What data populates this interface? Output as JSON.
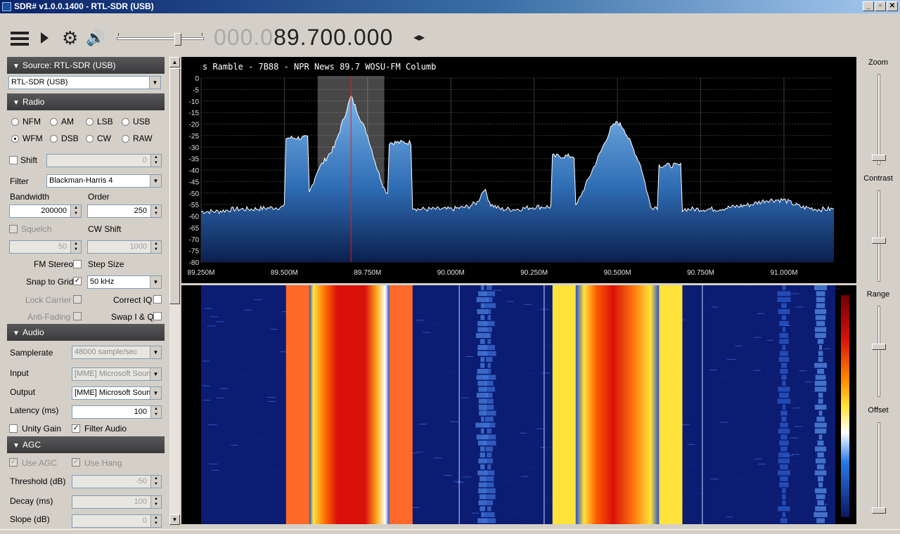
{
  "window": {
    "title": "SDR# v1.0.0.1400 - RTL-SDR (USB)",
    "buttons": {
      "minimize": "_",
      "restore": "▫",
      "close": "✕"
    }
  },
  "toolbar": {
    "menu_icon": "hamburger-menu-icon",
    "play_icon": "play-icon",
    "settings_icon": "gear-icon",
    "audio_icon": "speaker-icon",
    "volume_level": 0.72,
    "frequency_dim": "000.0",
    "frequency_main": "89.700.000",
    "freq_arrows": "◂▸"
  },
  "left": {
    "source": {
      "header": "Source: RTL-SDR (USB)",
      "device": "RTL-SDR (USB)"
    },
    "radio": {
      "header": "Radio",
      "modes": [
        "NFM",
        "AM",
        "LSB",
        "USB",
        "WFM",
        "DSB",
        "CW",
        "RAW"
      ],
      "selected_mode": "WFM",
      "shift_label": "Shift",
      "shift_value": "0",
      "filter_label": "Filter",
      "filter_value": "Blackman-Harris 4",
      "bandwidth_label": "Bandwidth",
      "bandwidth_value": "200000",
      "order_label": "Order",
      "order_value": "250",
      "squelch_label": "Squelch",
      "squelch_value": "50",
      "cwshift_label": "CW Shift",
      "cwshift_value": "1000",
      "fmstereo_label": "FM Stereo",
      "stepsize_label": "Step Size",
      "snap_label": "Snap to Grid",
      "stepsize_value": "50 kHz",
      "lockcarrier_label": "Lock Carrier",
      "correctiq_label": "Correct IQ",
      "antifading_label": "Anti-Fading",
      "swapiq_label": "Swap I & Q"
    },
    "audio": {
      "header": "Audio",
      "samplerate_label": "Samplerate",
      "samplerate_value": "48000 sample/sec",
      "input_label": "Input",
      "input_value": "[MME] Microsoft Soun",
      "output_label": "Output",
      "output_value": "[MME] Microsoft Soun",
      "latency_label": "Latency (ms)",
      "latency_value": "100",
      "unitygain_label": "Unity Gain",
      "filteraudio_label": "Filter Audio"
    },
    "agc": {
      "header": "AGC",
      "useagc_label": "Use AGC",
      "usehang_label": "Use Hang",
      "threshold_label": "Threshold (dB)",
      "threshold_value": "-50",
      "decay_label": "Decay (ms)",
      "decay_value": "100",
      "slope_label": "Slope (dB)",
      "slope_value": "0"
    }
  },
  "right": {
    "zoom_label": "Zoom",
    "contrast_label": "Contrast",
    "range_label": "Range",
    "offset_label": "Offset",
    "zoom_level": 0.05,
    "contrast_level": 0.45,
    "range_level": 0.55,
    "offset_level": 0.0
  },
  "chart_data": {
    "type": "area",
    "title": "s Ramble - 7B88 - NPR News 89.7 WOSU-FM Columb",
    "xlabel": "",
    "ylabel": "",
    "x_unit": "MHz",
    "xlim": [
      89.25,
      91.15
    ],
    "ylim": [
      -80,
      0
    ],
    "x_ticks": [
      "89.250M",
      "89.500M",
      "89.750M",
      "90.000M",
      "90.250M",
      "90.500M",
      "90.750M",
      "91.000M"
    ],
    "y_ticks": [
      "0",
      "-5",
      "-10",
      "-15",
      "-20",
      "-25",
      "-30",
      "-35",
      "-40",
      "-45",
      "-50",
      "-55",
      "-60",
      "-65",
      "-70",
      "-75",
      "-80"
    ],
    "tuned_frequency_mhz": 89.7,
    "filter_band_mhz": [
      89.6,
      89.8
    ],
    "grid": true,
    "series": [
      {
        "x": [
          89.25,
          89.3,
          89.35,
          89.4,
          89.5,
          89.505,
          89.55,
          89.57,
          89.575,
          89.6,
          89.65,
          89.7,
          89.75,
          89.78,
          89.8,
          89.81,
          89.815,
          89.88,
          89.885,
          89.9,
          89.95,
          90.0,
          90.05,
          90.08,
          90.1,
          90.12,
          90.15,
          90.2,
          90.25,
          90.28,
          90.3,
          90.305,
          90.37,
          90.375,
          90.4,
          90.45,
          90.48,
          90.5,
          90.52,
          90.57,
          90.6,
          90.62,
          90.625,
          90.69,
          90.695,
          90.75,
          90.8,
          90.85,
          90.9,
          90.95,
          91.0,
          91.05,
          91.1,
          91.15
        ],
        "values": [
          -58,
          -58,
          -57,
          -57,
          -56,
          -26,
          -26,
          -26,
          -50,
          -40,
          -30,
          -8,
          -25,
          -40,
          -48,
          -50,
          -28,
          -28,
          -56,
          -57,
          -57,
          -57,
          -56,
          -54,
          -48,
          -55,
          -57,
          -57,
          -56,
          -56,
          -56,
          -34,
          -34,
          -56,
          -48,
          -32,
          -22,
          -19,
          -22,
          -38,
          -56,
          -56,
          -38,
          -38,
          -57,
          -57,
          -57,
          -56,
          -55,
          -53,
          -53,
          -56,
          -57,
          -57
        ]
      }
    ]
  }
}
